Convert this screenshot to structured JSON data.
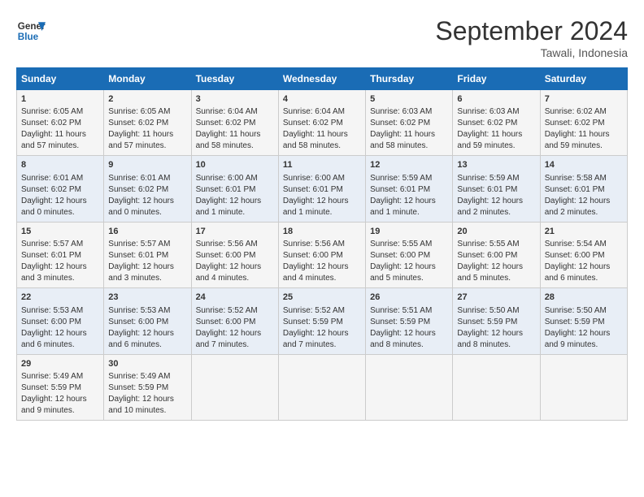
{
  "logo": {
    "line1": "General",
    "line2": "Blue"
  },
  "title": "September 2024",
  "location": "Tawali, Indonesia",
  "days_of_week": [
    "Sunday",
    "Monday",
    "Tuesday",
    "Wednesday",
    "Thursday",
    "Friday",
    "Saturday"
  ],
  "weeks": [
    [
      {
        "day": "1",
        "sunrise": "6:05 AM",
        "sunset": "6:02 PM",
        "daylight": "11 hours and 57 minutes."
      },
      {
        "day": "2",
        "sunrise": "6:05 AM",
        "sunset": "6:02 PM",
        "daylight": "11 hours and 57 minutes."
      },
      {
        "day": "3",
        "sunrise": "6:04 AM",
        "sunset": "6:02 PM",
        "daylight": "11 hours and 58 minutes."
      },
      {
        "day": "4",
        "sunrise": "6:04 AM",
        "sunset": "6:02 PM",
        "daylight": "11 hours and 58 minutes."
      },
      {
        "day": "5",
        "sunrise": "6:03 AM",
        "sunset": "6:02 PM",
        "daylight": "11 hours and 58 minutes."
      },
      {
        "day": "6",
        "sunrise": "6:03 AM",
        "sunset": "6:02 PM",
        "daylight": "11 hours and 59 minutes."
      },
      {
        "day": "7",
        "sunrise": "6:02 AM",
        "sunset": "6:02 PM",
        "daylight": "11 hours and 59 minutes."
      }
    ],
    [
      {
        "day": "8",
        "sunrise": "6:01 AM",
        "sunset": "6:02 PM",
        "daylight": "12 hours and 0 minutes."
      },
      {
        "day": "9",
        "sunrise": "6:01 AM",
        "sunset": "6:02 PM",
        "daylight": "12 hours and 0 minutes."
      },
      {
        "day": "10",
        "sunrise": "6:00 AM",
        "sunset": "6:01 PM",
        "daylight": "12 hours and 1 minute."
      },
      {
        "day": "11",
        "sunrise": "6:00 AM",
        "sunset": "6:01 PM",
        "daylight": "12 hours and 1 minute."
      },
      {
        "day": "12",
        "sunrise": "5:59 AM",
        "sunset": "6:01 PM",
        "daylight": "12 hours and 1 minute."
      },
      {
        "day": "13",
        "sunrise": "5:59 AM",
        "sunset": "6:01 PM",
        "daylight": "12 hours and 2 minutes."
      },
      {
        "day": "14",
        "sunrise": "5:58 AM",
        "sunset": "6:01 PM",
        "daylight": "12 hours and 2 minutes."
      }
    ],
    [
      {
        "day": "15",
        "sunrise": "5:57 AM",
        "sunset": "6:01 PM",
        "daylight": "12 hours and 3 minutes."
      },
      {
        "day": "16",
        "sunrise": "5:57 AM",
        "sunset": "6:01 PM",
        "daylight": "12 hours and 3 minutes."
      },
      {
        "day": "17",
        "sunrise": "5:56 AM",
        "sunset": "6:00 PM",
        "daylight": "12 hours and 4 minutes."
      },
      {
        "day": "18",
        "sunrise": "5:56 AM",
        "sunset": "6:00 PM",
        "daylight": "12 hours and 4 minutes."
      },
      {
        "day": "19",
        "sunrise": "5:55 AM",
        "sunset": "6:00 PM",
        "daylight": "12 hours and 5 minutes."
      },
      {
        "day": "20",
        "sunrise": "5:55 AM",
        "sunset": "6:00 PM",
        "daylight": "12 hours and 5 minutes."
      },
      {
        "day": "21",
        "sunrise": "5:54 AM",
        "sunset": "6:00 PM",
        "daylight": "12 hours and 6 minutes."
      }
    ],
    [
      {
        "day": "22",
        "sunrise": "5:53 AM",
        "sunset": "6:00 PM",
        "daylight": "12 hours and 6 minutes."
      },
      {
        "day": "23",
        "sunrise": "5:53 AM",
        "sunset": "6:00 PM",
        "daylight": "12 hours and 6 minutes."
      },
      {
        "day": "24",
        "sunrise": "5:52 AM",
        "sunset": "6:00 PM",
        "daylight": "12 hours and 7 minutes."
      },
      {
        "day": "25",
        "sunrise": "5:52 AM",
        "sunset": "5:59 PM",
        "daylight": "12 hours and 7 minutes."
      },
      {
        "day": "26",
        "sunrise": "5:51 AM",
        "sunset": "5:59 PM",
        "daylight": "12 hours and 8 minutes."
      },
      {
        "day": "27",
        "sunrise": "5:50 AM",
        "sunset": "5:59 PM",
        "daylight": "12 hours and 8 minutes."
      },
      {
        "day": "28",
        "sunrise": "5:50 AM",
        "sunset": "5:59 PM",
        "daylight": "12 hours and 9 minutes."
      }
    ],
    [
      {
        "day": "29",
        "sunrise": "5:49 AM",
        "sunset": "5:59 PM",
        "daylight": "12 hours and 9 minutes."
      },
      {
        "day": "30",
        "sunrise": "5:49 AM",
        "sunset": "5:59 PM",
        "daylight": "12 hours and 10 minutes."
      },
      null,
      null,
      null,
      null,
      null
    ]
  ]
}
